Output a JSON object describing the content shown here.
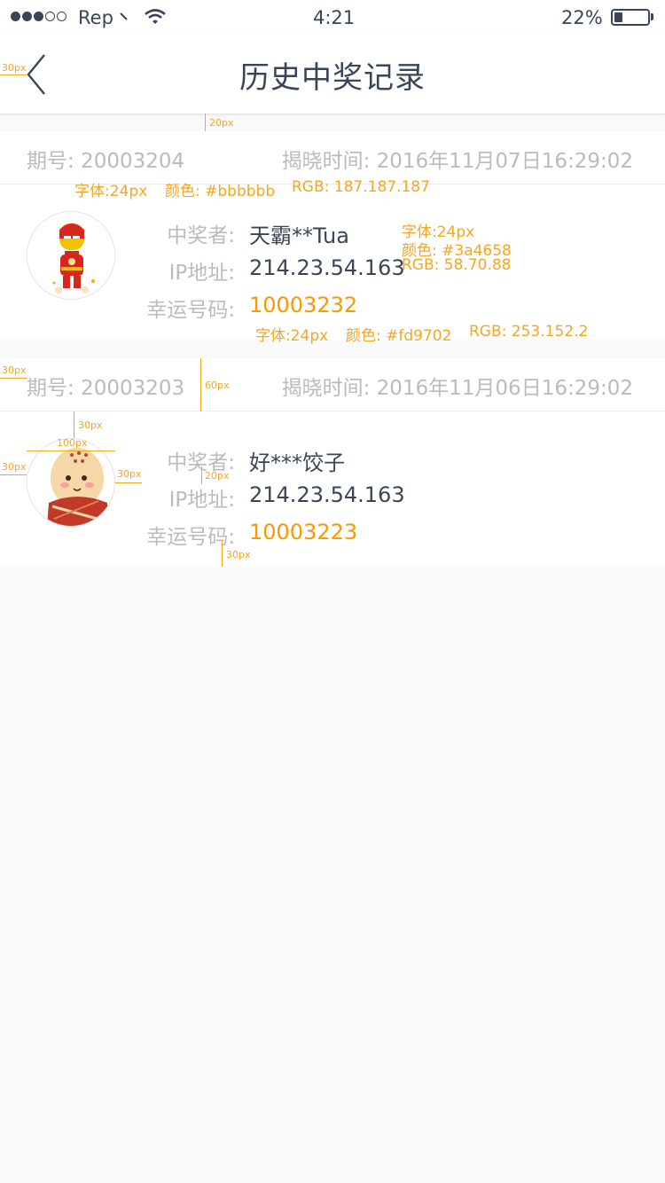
{
  "status_bar": {
    "carrier": "Rep",
    "time": "4:21",
    "battery_pct": "22%",
    "battery_level": 0.22
  },
  "nav": {
    "title": "历史中奖记录"
  },
  "records": [
    {
      "issue": "期号: 20003204",
      "reveal_time": "揭晓时间: 2016年11月07日16:29:02",
      "winner_label": "中奖者:",
      "winner": "天霸**Tua",
      "ip_label": "IP地址:",
      "ip": "214.23.54.163",
      "lucky_label": "幸运号码:",
      "lucky_number": "10003232",
      "avatar_icon": "iron-man-avatar"
    },
    {
      "issue": "期号: 20003203",
      "reveal_time": "揭晓时间: 2016年11月06日16:29:02",
      "winner_label": "中奖者:",
      "winner": "好***饺子",
      "ip_label": "IP地址:",
      "ip": "214.23.54.163",
      "lucky_label": "幸运号码:",
      "lucky_number": "10003223",
      "avatar_icon": "monk-avatar"
    }
  ],
  "annotations": {
    "header_font": "字体:24px",
    "header_color": "颜色: #bbbbbb",
    "header_rgb": "RGB: 187.187.187",
    "winner_font": "字体:24px",
    "winner_color": "颜色: #3a4658",
    "winner_rgb": "RGB: 58.70.88",
    "lucky_font": "字体:24px",
    "lucky_color": "颜色: #fd9702",
    "lucky_rgb": "RGB: 253.152.2",
    "d_30px": "30px",
    "d_20px": "20px",
    "d_60px": "60px",
    "d_100px": "100px"
  },
  "colors": {
    "text_gray": "#bbbbbb",
    "text_dark": "#3a4658",
    "accent": "#fd9702",
    "annotation": "#f5a623"
  }
}
